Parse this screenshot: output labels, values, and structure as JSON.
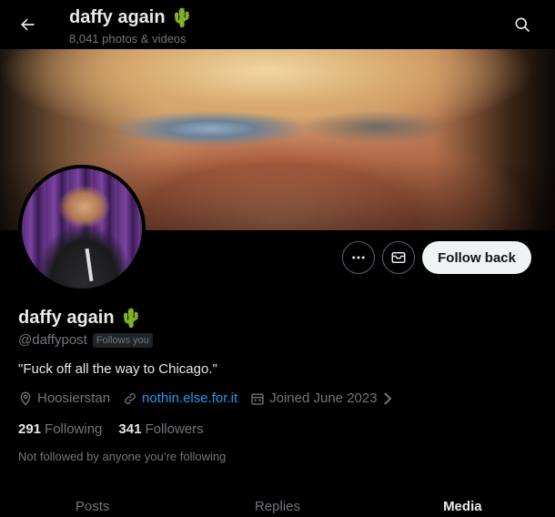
{
  "header": {
    "title": "daffy again",
    "title_emoji": "🌵",
    "subtitle": "8,041 photos & videos"
  },
  "profile": {
    "name": "daffy again",
    "name_emoji": "🌵",
    "handle": "@daffypost",
    "follows_you_badge": "Follows you",
    "bio": "\"Fuck off all the way to Chicago.\"",
    "location": "Hoosierstan",
    "website": "nothin.else.for.it",
    "joined": "Joined June 2023",
    "following_count": "291",
    "following_label": "Following",
    "followers_count": "341",
    "followers_label": "Followers",
    "not_followed_text": "Not followed by anyone you’re following"
  },
  "actions": {
    "follow_back_label": "Follow back"
  },
  "tabs": [
    {
      "label": "Posts",
      "active": false
    },
    {
      "label": "Replies",
      "active": false
    },
    {
      "label": "Media",
      "active": true
    }
  ],
  "colors": {
    "background": "#000000",
    "accent": "#1d9bf0",
    "primary_text": "#e7e9ea",
    "secondary_text": "#71767b"
  }
}
